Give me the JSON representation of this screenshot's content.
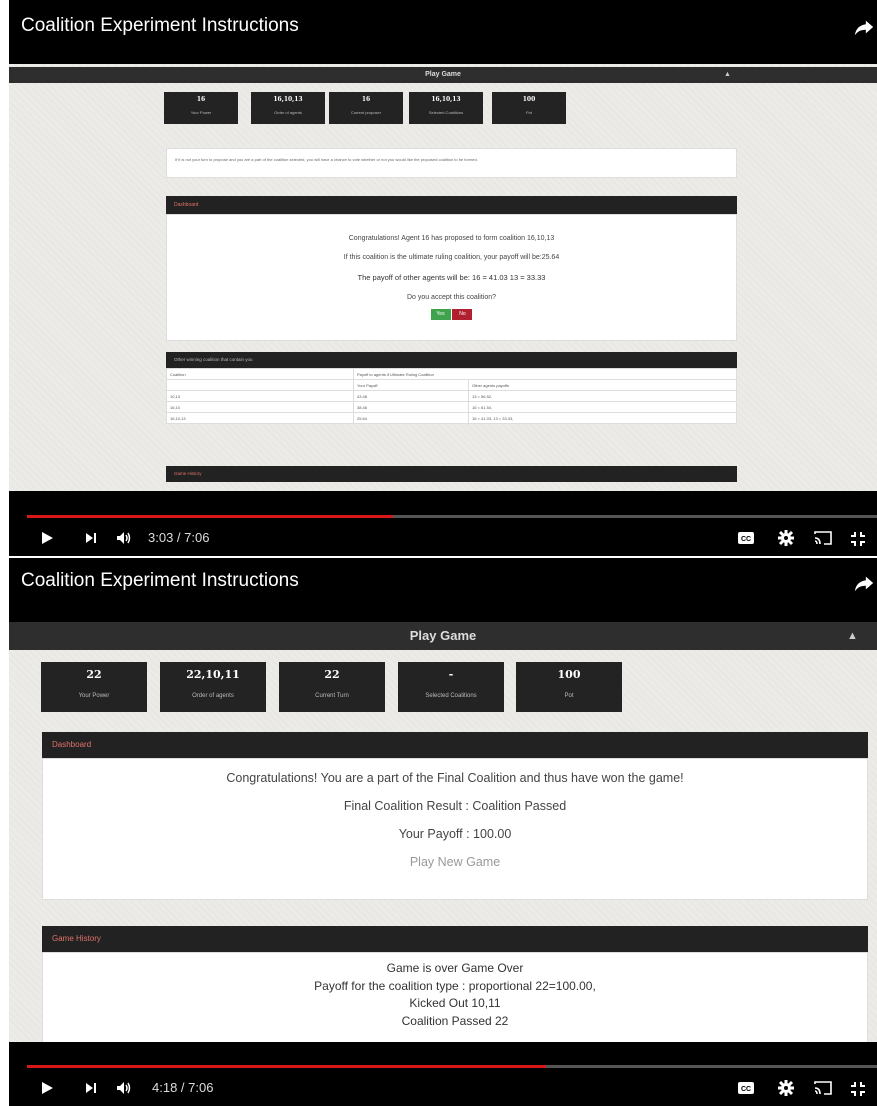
{
  "frame1": {
    "video_title": "Coalition Experiment Instructions",
    "topbar_title": "Play Game",
    "stats": [
      {
        "value": "16",
        "label": "Your Power"
      },
      {
        "value": "16,10,13",
        "label": "Order of agents"
      },
      {
        "value": "16",
        "label": "Current proposer"
      },
      {
        "value": "16,10,13",
        "label": "Selected Coalitions"
      },
      {
        "value": "100",
        "label": "Pot"
      }
    ],
    "note": "If it is not your turn to propose and you are a part of the coalition selected, you will have a chance to vote whether or not you would like the proposed coalition to be formed.",
    "dashboard": {
      "header": "Dashboard",
      "line1": "Congratulations! Agent 16 has proposed to form coalition 16,10,13",
      "line2": "If this coalition is the ultimate ruling coalition, your payoff will be:25.64",
      "line3": "The payoff of other agents will be: 16 = 41.03 13 = 33.33",
      "question": "Do you accept this coalition?",
      "yes_label": "Yes",
      "no_label": "No"
    },
    "other_coalitions": {
      "header": "Other winning coalition that contain you",
      "col1": "Coalition",
      "col2": "Payoff to agents if Ultimate Ruling Coalition",
      "sub1": "Your Payoff",
      "sub2": "Other agents payoffs",
      "rows": [
        {
          "coalition": "10,13",
          "your": "43.48",
          "others": "13 = 56.52,"
        },
        {
          "coalition": "16,10",
          "your": "38.46",
          "others": "16 = 61.54,"
        },
        {
          "coalition": "16,10,13",
          "your": "25.64",
          "others": "16 = 41.03, 13 = 33.33,"
        }
      ]
    },
    "history_header": "Game History",
    "time": "3:03 / 7:06",
    "progress": 0.43
  },
  "frame2": {
    "video_title": "Coalition Experiment Instructions",
    "topbar_title": "Play Game",
    "stats": [
      {
        "value": "22",
        "label": "Your Power"
      },
      {
        "value": "22,10,11",
        "label": "Order of agents"
      },
      {
        "value": "22",
        "label": "Current Turn"
      },
      {
        "value": "-",
        "label": "Selected Coalitions"
      },
      {
        "value": "100",
        "label": "Pot"
      }
    ],
    "dashboard": {
      "header": "Dashboard",
      "line1": "Congratulations! You are a part of the Final Coalition and thus have won the game!",
      "line2": "Final Coalition Result : Coalition Passed",
      "line3": "Your Payoff : 100.00",
      "play_new": "Play New Game"
    },
    "history": {
      "header": "Game History",
      "lines": [
        "Game is over Game Over",
        "Payoff for the coalition type : proportional 22=100.00,",
        "Kicked Out 10,11",
        "Coalition Passed 22"
      ]
    },
    "time": "4:18 / 7:06",
    "progress": 0.61
  },
  "icons": {
    "share": "share-icon",
    "user": "user-icon",
    "play": "play-icon",
    "next": "next-icon",
    "volume": "volume-icon",
    "cc": "captions-icon",
    "settings": "gear-icon",
    "cast": "cast-icon",
    "fullscreen": "exit-fullscreen-icon"
  },
  "colors": {
    "progress": "#d81818",
    "panel_header_text": "#e0736a",
    "yes": "#3fa34d",
    "no": "#b0202e"
  }
}
